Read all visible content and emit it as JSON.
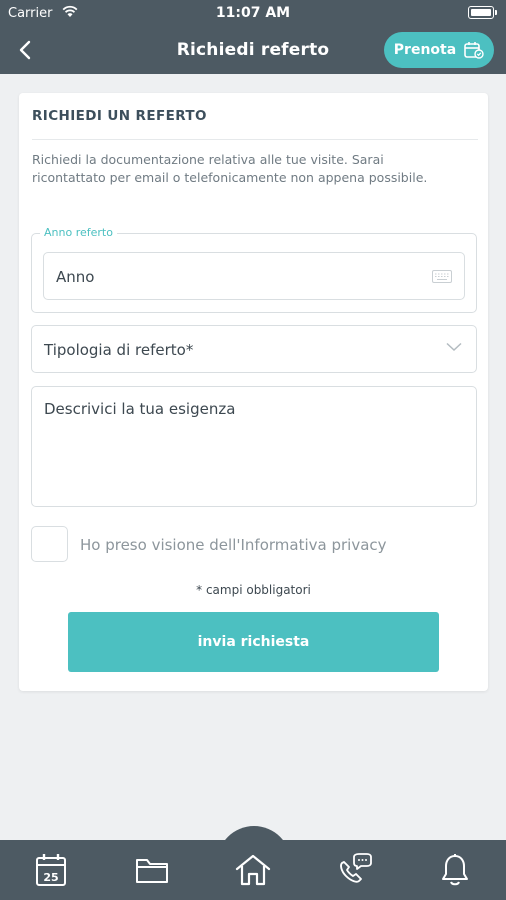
{
  "status_bar": {
    "carrier": "Carrier",
    "time": "11:07 AM"
  },
  "nav": {
    "title": "Richiedi referto",
    "book_label": "Prenota"
  },
  "form": {
    "heading": "RICHIEDI UN REFERTO",
    "intro": "Richiedi la documentazione relativa alle tue visite. Sarai ricontattato per email o telefonicamente non appena possibile.",
    "year_legend": "Anno referto",
    "year_value": "Anno",
    "type_label": "Tipologia di referto*",
    "description_placeholder": "Descrivici la tua esigenza",
    "privacy_label": "Ho preso visione dell'Informativa privacy",
    "required_note": "* campi obbligatori",
    "submit_label": "invia richiesta"
  },
  "tab_bar": {
    "calendar_day": "25",
    "items": [
      "calendar",
      "folder",
      "home",
      "contact",
      "notifications"
    ]
  },
  "colors": {
    "header": "#4d5a63",
    "accent": "#4cc0c1",
    "background": "#eef0f2"
  }
}
